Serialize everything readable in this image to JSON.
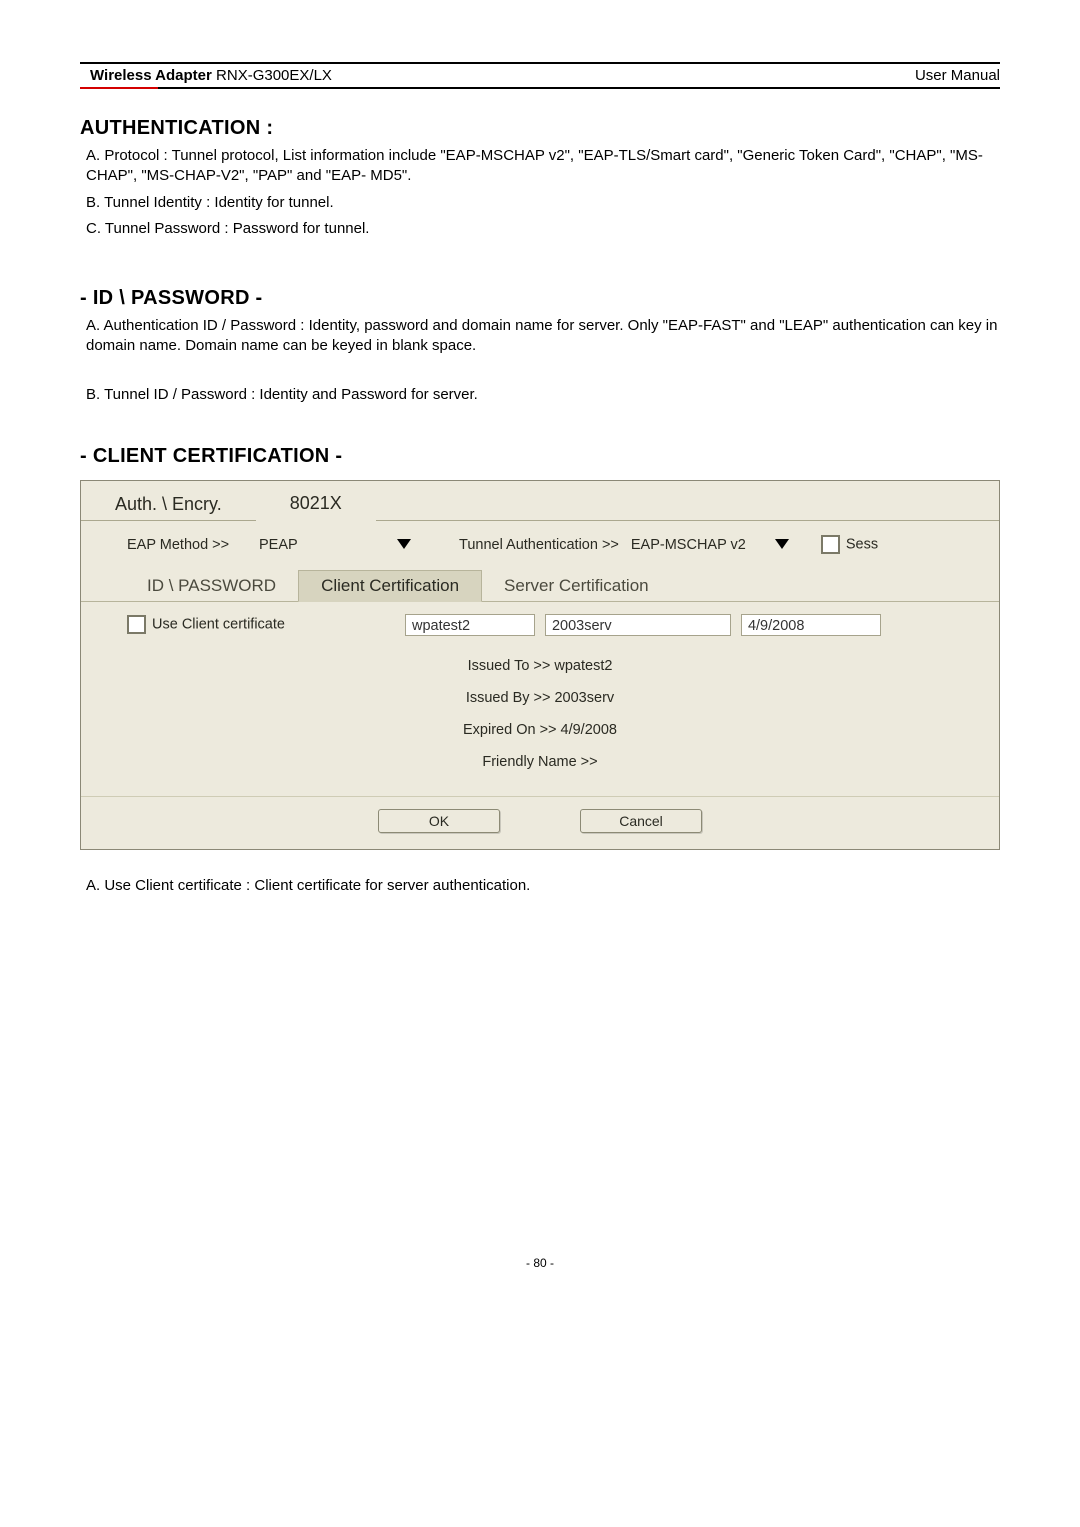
{
  "header": {
    "left_bold": "Wireless Adapter",
    "left_rest": " RNX-G300EX/LX",
    "right": "User Manual"
  },
  "sections": {
    "auth": {
      "title": "AUTHENTICATION :",
      "a": "A. Protocol : Tunnel protocol, List information include \"EAP-MSCHAP v2\", \"EAP-TLS/Smart card\", \"Generic Token Card\", \"CHAP\", \"MS-CHAP\", \"MS-CHAP-V2\", \"PAP\" and \"EAP- MD5\".",
      "b": "B. Tunnel Identity : Identity for tunnel.",
      "c": "C. Tunnel Password : Password for tunnel."
    },
    "idp": {
      "title": "- ID \\ PASSWORD -",
      "a": "A. Authentication ID / Password : Identity, password and domain name for server. Only \"EAP-FAST\" and \"LEAP\" authentication can key in domain name. Domain name can be keyed in blank space.",
      "b": "B. Tunnel ID / Password : Identity and Password for server."
    },
    "cc": {
      "title": "- CLIENT CERTIFICATION -",
      "below": "A. Use Client certificate : Client certificate for server authentication."
    }
  },
  "dialog": {
    "toptabs": {
      "t1": "Auth. \\ Encry.",
      "t2": "8021X"
    },
    "eap_label": "EAP Method >>",
    "eap_value": "PEAP",
    "tunnel_label": "Tunnel Authentication >>",
    "tunnel_value": "EAP-MSCHAP v2",
    "sess_label": "Sess",
    "subtabs": {
      "s1": "ID \\ PASSWORD",
      "s2": "Client Certification",
      "s3": "Server Certification"
    },
    "use_client_label": "Use Client certificate",
    "cert_fields": {
      "f1": "wpatest2",
      "f2": "2003serv",
      "f3": "4/9/2008"
    },
    "info": {
      "issued_to": "Issued To >> wpatest2",
      "issued_by": "Issued By >> 2003serv",
      "expired": "Expired On >> 4/9/2008",
      "friendly": "Friendly Name >>"
    },
    "buttons": {
      "ok": "OK",
      "cancel": "Cancel"
    }
  },
  "page_number": "- 80 -"
}
